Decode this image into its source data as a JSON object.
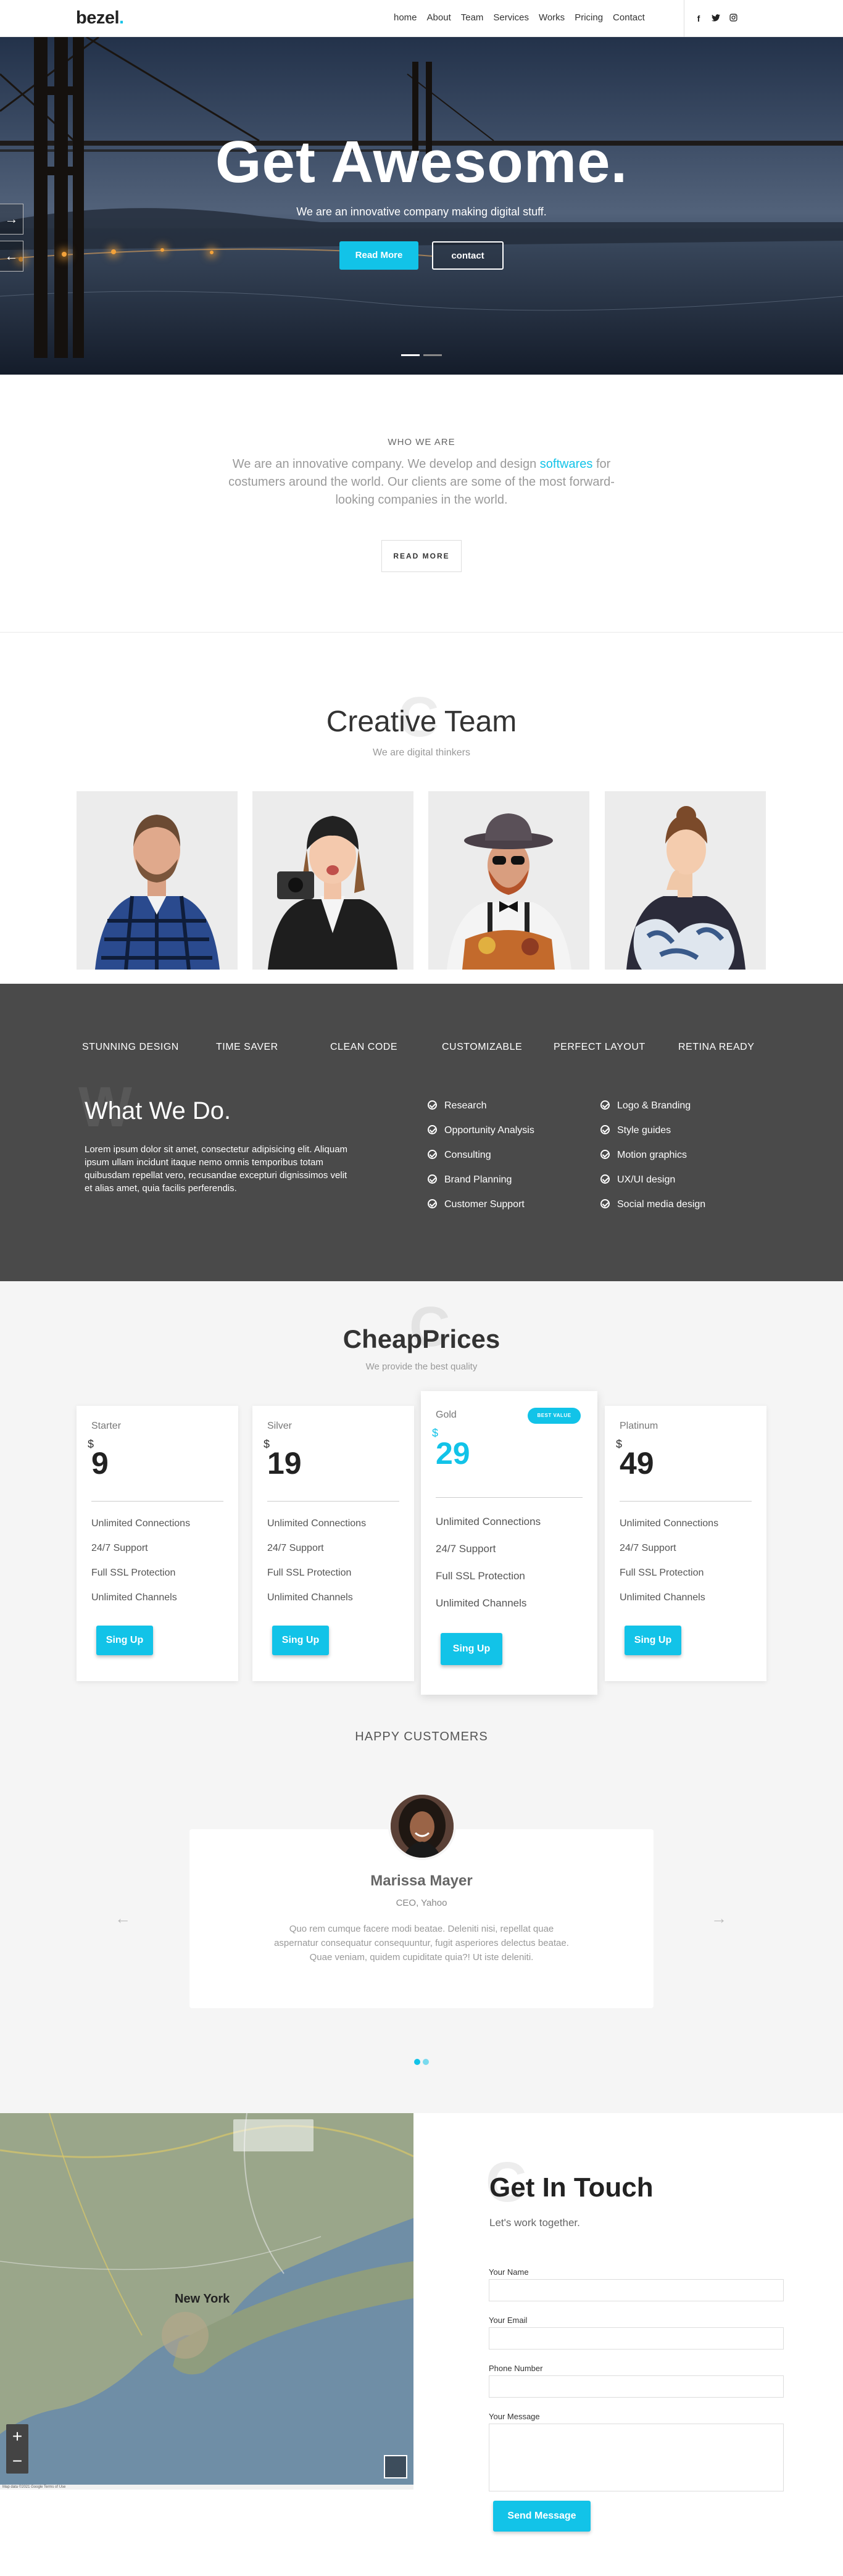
{
  "header": {
    "logo": "bezel",
    "logo_dot": ".",
    "nav": [
      "home",
      "About",
      "Team",
      "Services",
      "Works",
      "Pricing",
      "Contact"
    ],
    "social": [
      "facebook-icon",
      "twitter-icon",
      "instagram-icon"
    ]
  },
  "hero": {
    "title": "Get Awesome.",
    "subtitle": "We are an innovative company making digital stuff.",
    "read_more": "Read More",
    "contact": "contact",
    "next_arrow": "→",
    "prev_arrow": "←"
  },
  "who": {
    "label": "WHO WE ARE",
    "text_before": "We are an innovative company. We develop and design ",
    "text_highlight": "softwares",
    "text_after": " for costumers around the world. Our clients are some of the most forward-looking companies in the world.",
    "button": "READ MORE"
  },
  "team": {
    "bg_letter": "C",
    "title": "Creative Team",
    "subtitle": "We are digital thinkers"
  },
  "what": {
    "features": [
      "STUNNING DESIGN",
      "TIME SAVER",
      "CLEAN CODE",
      "CUSTOMIZABLE",
      "PERFECT LAYOUT",
      "RETINA READY"
    ],
    "bg_letter": "W",
    "title": "What We Do.",
    "text": "Lorem ipsum dolor sit amet, consectetur adipisicing elit. Aliquam ipsum ullam incidunt itaque nemo omnis temporibus totam quibusdam repellat vero, recusandae excepturi dignissimos velit et alias amet, quia facilis perferendis.",
    "services_col1": [
      "Research",
      "Opportunity Analysis",
      "Consulting",
      "Brand Planning",
      "Customer Support"
    ],
    "services_col2": [
      "Logo & Branding",
      "Style guides",
      "Motion graphics",
      "UX/UI design",
      "Social media design"
    ]
  },
  "pricing": {
    "bg_letter": "C",
    "title": "CheapPrices",
    "subtitle": "We provide the best quality",
    "currency": "$",
    "features": [
      "Unlimited Connections",
      "24/7 Support",
      "Full SSL Protection",
      "Unlimited Channels"
    ],
    "button": "Sing Up",
    "best_value": "BEST VALUE",
    "plans": [
      {
        "name": "Starter",
        "price": "9"
      },
      {
        "name": "Silver",
        "price": "19"
      },
      {
        "name": "Gold",
        "price": "29"
      },
      {
        "name": "Platinum",
        "price": "49"
      }
    ]
  },
  "testimonial": {
    "heading": "HAPPY CUSTOMERS",
    "name": "Marissa Mayer",
    "role": "CEO, Yahoo",
    "quote": "Quo rem cumque facere modi beatae. Deleniti nisi, repellat quae aspernatur consequatur consequuntur, fugit asperiores delectus beatae. Quae veniam, quidem cupiditate quia?! Ut iste deleniti.",
    "prev": "←",
    "next": "→"
  },
  "map": {
    "city": "New York",
    "zoom_in": "+",
    "zoom_out": "−",
    "footer": "Map data ©2021 Google  Terms of Use"
  },
  "contact": {
    "bg_letter": "C",
    "title": "Get In Touch",
    "subtitle": "Let's work together.",
    "fields": [
      "Your Name",
      "Your Email",
      "Phone Number",
      "Your Message"
    ],
    "send": "Send Message"
  },
  "colors": {
    "accent": "#12c3e8",
    "dark": "#4a4a4a"
  }
}
